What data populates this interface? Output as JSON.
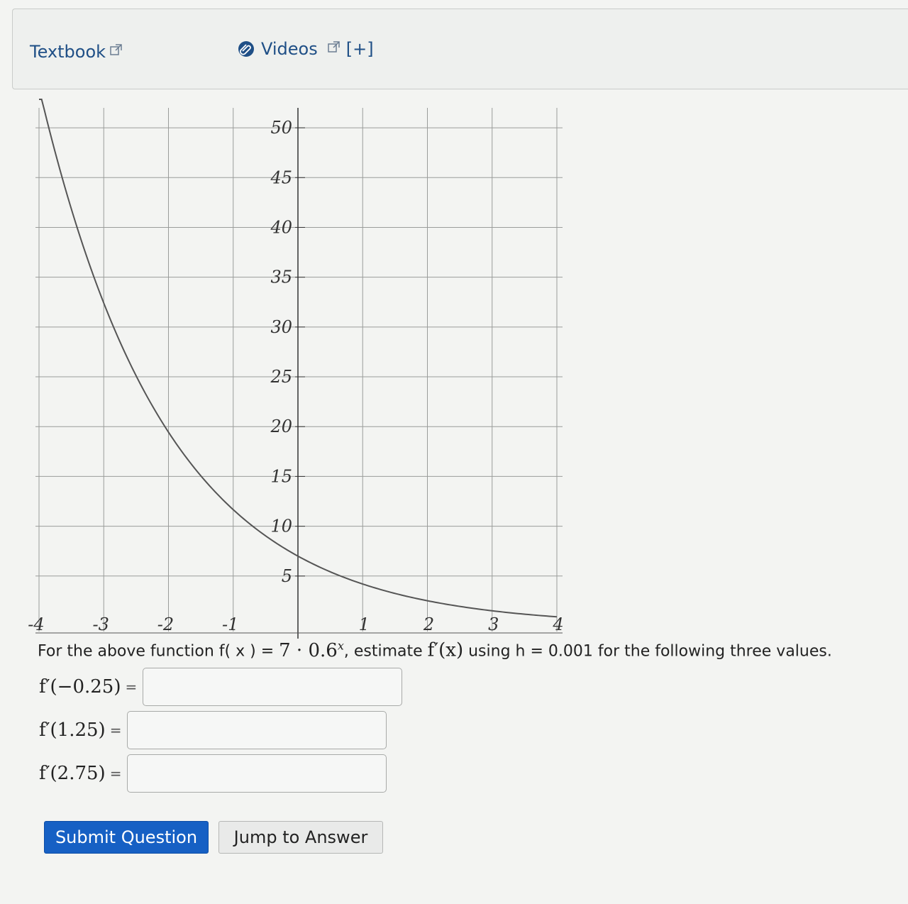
{
  "resources": {
    "textbook_label": "Textbook",
    "videos_label": "Videos",
    "expand_label": "[+]"
  },
  "chart_data": {
    "type": "line",
    "function": "7 * 0.6^x",
    "x_ticks": [
      "-4",
      "-3",
      "-2",
      "-1",
      "1",
      "2",
      "3",
      "4"
    ],
    "y_ticks": [
      "5",
      "10",
      "15",
      "20",
      "25",
      "30",
      "35",
      "40",
      "45",
      "50"
    ],
    "xlim": [
      -4,
      4
    ],
    "ylim": [
      0,
      52
    ],
    "grid": true,
    "series": [
      {
        "x": [
          -4,
          -3.5,
          -3,
          -2.5,
          -2,
          -1.5,
          -1,
          -0.5,
          0,
          0.5,
          1,
          1.5,
          2,
          2.5,
          3,
          3.5,
          4
        ],
        "y": [
          54.01,
          41.83,
          32.41,
          25.1,
          19.44,
          15.06,
          11.67,
          9.04,
          7.0,
          5.42,
          4.2,
          3.25,
          2.52,
          1.95,
          1.51,
          1.17,
          0.91
        ]
      }
    ]
  },
  "question": {
    "prefix": "For the above function f( x ) = ",
    "formula": "7 · 0.6",
    "exponent": "x",
    "middle": ", estimate ",
    "derivative": "f′(x)",
    "suffix": " using h = 0.001 for the following three values."
  },
  "answers": [
    {
      "label": "f′(−0.25)",
      "eq": "=",
      "value": ""
    },
    {
      "label": "f′(1.25)",
      "eq": "=",
      "value": ""
    },
    {
      "label": "f′(2.75)",
      "eq": "=",
      "value": ""
    }
  ],
  "buttons": {
    "submit": "Submit Question",
    "jump": "Jump to Answer"
  }
}
